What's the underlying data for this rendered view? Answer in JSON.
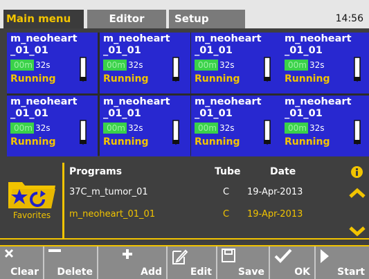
{
  "tabs": {
    "main": "Main menu",
    "editor": "Editor",
    "setup": "Setup"
  },
  "clock": "14:56",
  "cells": [
    {
      "name_line1": "m_neoheart",
      "name_line2": "_01_01",
      "minutes": "00m",
      "seconds": "32s",
      "status": "Running"
    },
    {
      "name_line1": "m_neoheart",
      "name_line2": "_01_01",
      "minutes": "00m",
      "seconds": "32s",
      "status": "Running"
    },
    {
      "name_line1": "m_neoheart",
      "name_line2": "_01_01",
      "minutes": "00m",
      "seconds": "32s",
      "status": "Running"
    },
    {
      "name_line1": "m_neoheart",
      "name_line2": "_01_01",
      "minutes": "00m",
      "seconds": "32s",
      "status": "Running"
    },
    {
      "name_line1": "m_neoheart",
      "name_line2": "_01_01",
      "minutes": "00m",
      "seconds": "32s",
      "status": "Running"
    },
    {
      "name_line1": "m_neoheart",
      "name_line2": "_01_01",
      "minutes": "00m",
      "seconds": "32s",
      "status": "Running"
    },
    {
      "name_line1": "m_neoheart",
      "name_line2": "_01_01",
      "minutes": "00m",
      "seconds": "32s",
      "status": "Running"
    },
    {
      "name_line1": "m_neoheart",
      "name_line2": "_01_01",
      "minutes": "00m",
      "seconds": "32s",
      "status": "Running"
    }
  ],
  "favorites_label": "Favorites",
  "program_list": {
    "headers": {
      "programs": "Programs",
      "tube": "Tube",
      "date": "Date"
    },
    "rows": [
      {
        "program": "37C_m_tumor_01",
        "tube": "C",
        "date": "19-Apr-2013",
        "selected": false
      },
      {
        "program": "m_neoheart_01_01",
        "tube": "C",
        "date": "19-Apr-2013",
        "selected": true
      }
    ]
  },
  "toolbar": {
    "clear": "Clear",
    "delete": "Delete",
    "add": "Add",
    "edit": "Edit",
    "save": "Save",
    "ok": "OK",
    "start": "Start"
  },
  "icons": {
    "info": "info-icon",
    "up": "chevron-up-icon",
    "down": "chevron-down-icon",
    "favorites": "folder-star-icon",
    "tube": "tube-icon"
  },
  "colors": {
    "accent": "#f2c400",
    "cell_bg": "#2828d0",
    "timer_bg": "#3ad14a",
    "panel_bg": "#3f3f3f"
  }
}
